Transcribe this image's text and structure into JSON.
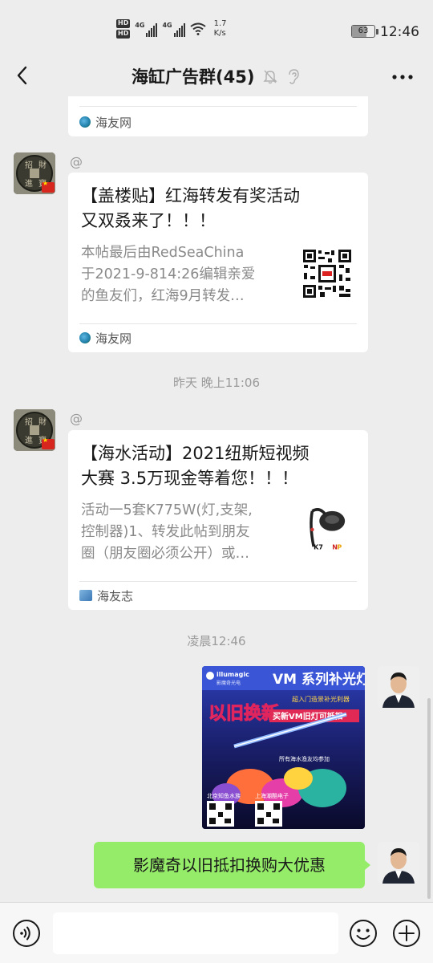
{
  "status_bar": {
    "hd1": "HD",
    "hd2": "HD",
    "net1": "4G",
    "net2": "4G",
    "speed_value": "1.7",
    "speed_unit": "K/s",
    "battery": "63",
    "battery_level": 0.63,
    "time": "12:46"
  },
  "header": {
    "title": "海缸广告群(45)",
    "icons": [
      "back-arrow-icon",
      "mute-bell-icon",
      "ear-icon",
      "more-dots-icon"
    ]
  },
  "messages": {
    "card0": {
      "source": "海友网"
    },
    "card1": {
      "sender": "@",
      "title": "【盖楼贴】红海转发有奖活动又双叒来了！！！",
      "title_line1": "【盖楼贴】红海转发有奖活动",
      "title_line2": "又双叒来了！！！",
      "desc_line1": "本帖最后由RedSeaChina",
      "desc_line2": "于2021-9-814:26编辑亲爱",
      "desc_line3": "的鱼友们，红海9月转发…",
      "source": "海友网"
    },
    "timestamp1": "昨天 晚上11:06",
    "card2": {
      "sender": "@",
      "title_line1": "【海水活动】2021纽斯短视频",
      "title_line2": "大赛 3.5万现金等着您！！！",
      "desc_line1": "活动一5套K775W(灯,支架,",
      "desc_line2": "控制器)1、转发此帖到朋友",
      "desc_line3": "圈（朋友圈必须公开）或…",
      "source": "海友志",
      "thumb_label": "K7"
    },
    "timestamp2": "凌晨12:46",
    "poster": {
      "brand": "illumagic",
      "brand_cn": "影魔奇光电",
      "headline": "VM 系列补光灯",
      "sub1": "以旧换新",
      "sub2": "买新VM旧灯可抵扣",
      "tagline": "超入门造景补光利器",
      "note": "所有海水渔友均参加",
      "store1": "北京知鱼水族",
      "store2": "上海潮酷电子"
    },
    "text_msg": "影魔奇以旧抵扣换购大优惠"
  },
  "input_bar": {
    "placeholder": "",
    "icons": [
      "voice-icon",
      "emoji-icon",
      "plus-icon"
    ]
  },
  "colors": {
    "bg": "#ededed",
    "bubble_green": "#95ec69",
    "card_bg": "#ffffff"
  }
}
